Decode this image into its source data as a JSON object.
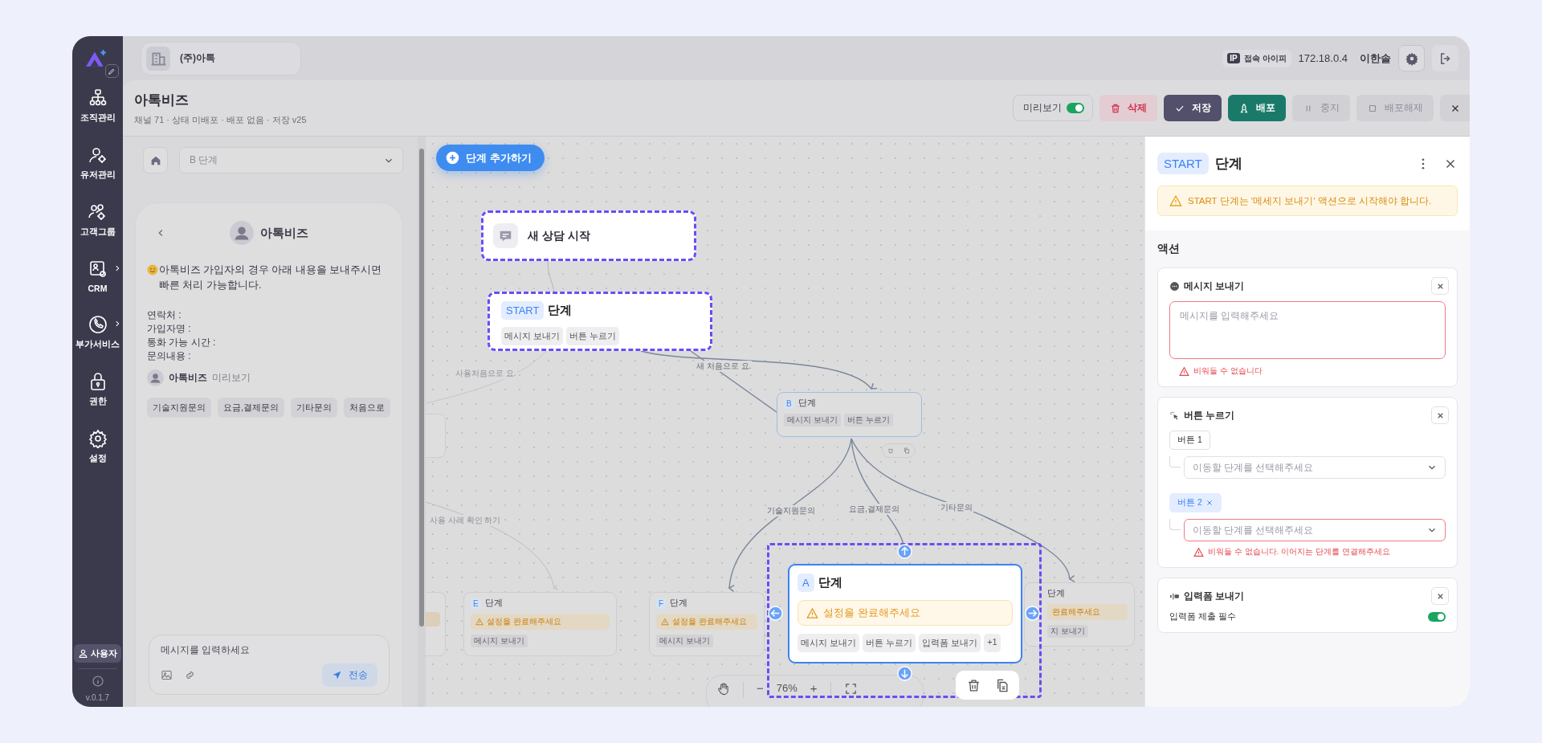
{
  "sidebar": {
    "items": [
      {
        "label": "조직관리",
        "submenu": false,
        "selected": false
      },
      {
        "label": "유저관리",
        "submenu": false,
        "selected": false
      },
      {
        "label": "고객그룹",
        "submenu": false,
        "selected": false
      },
      {
        "label": "CRM",
        "submenu": true,
        "selected": false
      },
      {
        "label": "부가서비스",
        "submenu": true,
        "selected": false
      },
      {
        "label": "권한",
        "submenu": false,
        "selected": false
      },
      {
        "label": "설정",
        "submenu": false,
        "selected": false
      }
    ],
    "user_button": "사용자",
    "version": "v.0.1.7"
  },
  "topbar": {
    "workspace": "(주)아톡",
    "ip_badge": "IP",
    "ip_label": "접속 아이피",
    "ip": "172.18.0.4",
    "user": "이한솔"
  },
  "header": {
    "title": "아톡비즈",
    "subtitle": "채널 71 · 상태 미배포 · 배포 없음 · 저장 v25",
    "preview": {
      "label": "미리보기",
      "on": true
    },
    "actions": [
      {
        "label": "삭제",
        "kind": "danger",
        "disabled": false
      },
      {
        "label": "저장",
        "kind": "dark",
        "disabled": false
      },
      {
        "label": "배포",
        "kind": "primary",
        "disabled": false
      },
      {
        "label": "중지",
        "kind": "plain",
        "disabled": true
      },
      {
        "label": "배포해제",
        "kind": "plain",
        "disabled": true
      }
    ]
  },
  "chat_preview": {
    "step_select": "B 단계",
    "bot_name": "아톡비즈",
    "message": "아톡비즈 가입자의 경우 아래 내용을 보내주시면 빠른 처리 가능합니다.",
    "fields": [
      "연락처 :",
      "가입자명 :",
      "통화 가능 시간 :",
      "문의내용 :"
    ],
    "sender": "아톡비즈",
    "sender_tag": "미리보기",
    "quick_replies": [
      "기술지원문의",
      "요금,결제문의",
      "기타문의",
      "처음으로"
    ],
    "composer_placeholder": "메시지를 입력하세요",
    "send_button": "전송"
  },
  "canvas": {
    "add_step_button": "단계 추가하기",
    "nodes": [
      {
        "kind": "trigger",
        "title": "새 상담 시작",
        "highlighted": true,
        "selected": false,
        "previewing": false
      },
      {
        "kind": "step",
        "badge": "START",
        "title": "단계",
        "highlighted": true,
        "selected": false,
        "previewing": false,
        "chips": [
          "메시지 보내기",
          "버튼 누르기"
        ]
      },
      {
        "kind": "step",
        "badge": "B",
        "title": "단계",
        "highlighted": false,
        "selected": false,
        "previewing": true,
        "chips": [
          "메시지 보내기",
          "버튼 누르기"
        ]
      },
      {
        "kind": "step",
        "badge": "E",
        "title": "단계",
        "highlighted": false,
        "selected": false,
        "previewing": false,
        "warning": "설정을 완료해주세요",
        "chips": [
          "메시지 보내기"
        ]
      },
      {
        "kind": "step",
        "badge": "F",
        "title": "단계",
        "highlighted": false,
        "selected": false,
        "previewing": false,
        "warning": "설정을 완료해주세요",
        "chips": [
          "메시지 보내기"
        ]
      },
      {
        "kind": "step",
        "badge": "A",
        "title": "단계",
        "highlighted": false,
        "selected": true,
        "previewing": false,
        "warning": "설정을 완료해주세요",
        "chips": [
          "메시지 보내기",
          "버튼 누르기",
          "입력폼 보내기",
          "+1"
        ]
      },
      {
        "kind": "cut_step",
        "title": "단계",
        "highlighted": false,
        "selected": false,
        "previewing": false,
        "warning": "완료해주세요",
        "chips": [
          "지 보내기"
        ]
      }
    ],
    "edge_labels": [
      {
        "text": "새 처음으로 요.",
        "faint": false
      },
      {
        "text": "사용처음으로 요.",
        "faint": true
      },
      {
        "text": "사용 사례 확인 하기",
        "faint": true
      },
      {
        "text": "기술지원문의",
        "faint": false
      },
      {
        "text": "요금,결제문의",
        "faint": false
      },
      {
        "text": "기타문의",
        "faint": false
      }
    ],
    "zoom": {
      "minus": "−",
      "value": "76%",
      "plus": "+"
    }
  },
  "panel": {
    "badge": "START",
    "title": "단계",
    "warning": "START 단계는 '메세지 보내기' 액션으로 시작해야 합니다.",
    "section": "액션",
    "actions": [
      {
        "kind": "message",
        "title": "메시지 보내기",
        "placeholder": "메시지를 입력해주세요",
        "error": "비워둘 수 없습니다"
      },
      {
        "kind": "buttons",
        "title": "버튼 누르기",
        "buttons": [
          {
            "label": "버튼 1",
            "selected": false,
            "placeholder": "이동할 단계를 선택해주세요"
          },
          {
            "label": "버튼 2",
            "selected": true,
            "placeholder": "이동할 단계를 선택해주세요",
            "error": "비워둘 수 없습니다. 이어지는 단계를 연결해주세요"
          }
        ]
      },
      {
        "kind": "form",
        "title": "입력폼 보내기",
        "option": "입력폼 제출 필수",
        "on": true
      }
    ]
  }
}
